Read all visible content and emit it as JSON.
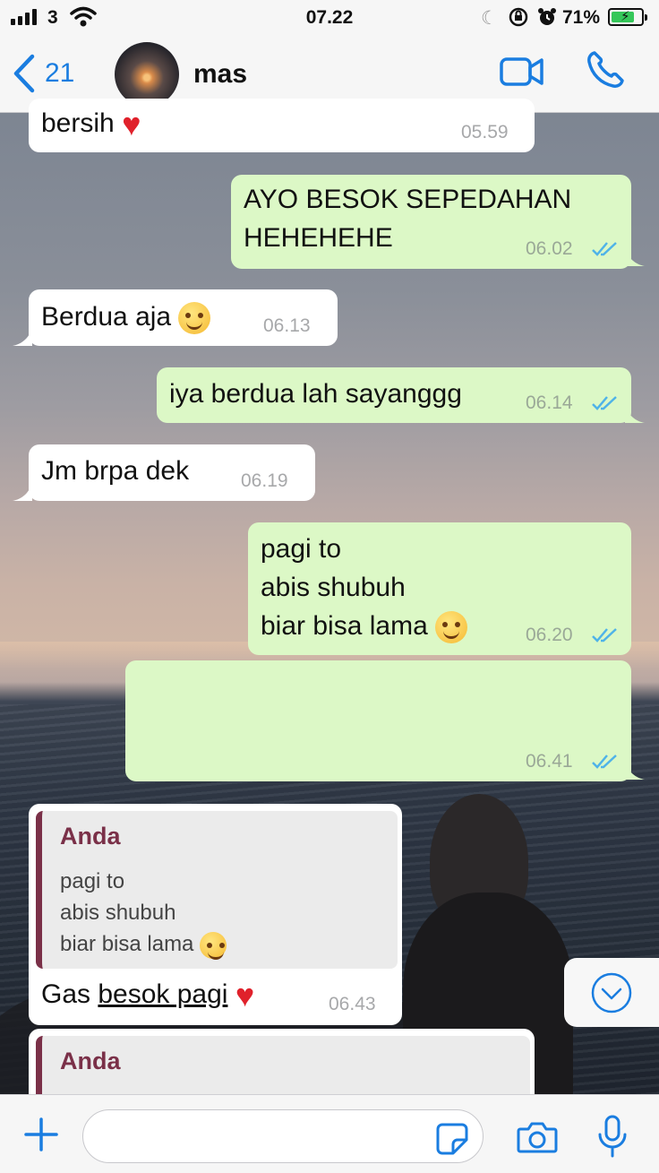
{
  "status_bar": {
    "carrier": "3",
    "time": "07.22",
    "battery_percent": "71%"
  },
  "header": {
    "back_count": "21",
    "contact_name": "mas"
  },
  "messages": [
    {
      "id": "m0",
      "direction": "incoming",
      "text": "bersih",
      "emoji": "red-heart",
      "time": "05.59"
    },
    {
      "id": "m1",
      "direction": "outgoing",
      "lines": [
        "AYO BESOK SEPEDAHAN",
        "HEHEHEHE"
      ],
      "time": "06.02",
      "status": "read"
    },
    {
      "id": "m2",
      "direction": "incoming",
      "text": "Berdua aja",
      "emoji": "face-with-hand-smile",
      "time": "06.13"
    },
    {
      "id": "m3",
      "direction": "outgoing",
      "text": "iya berdua lah sayanggg",
      "time": "06.14",
      "status": "read"
    },
    {
      "id": "m4",
      "direction": "incoming",
      "text": "Jm brpa dek",
      "time": "06.19"
    },
    {
      "id": "m5",
      "direction": "outgoing",
      "lines": [
        "pagi to",
        "abis shubuh",
        "biar bisa lama"
      ],
      "emoji": "savoring-face",
      "time": "06.20",
      "status": "read"
    },
    {
      "id": "m6",
      "direction": "outgoing",
      "text": "",
      "time": "06.41",
      "status": "read"
    },
    {
      "id": "m7",
      "direction": "incoming",
      "quote": {
        "author": "Anda",
        "lines": [
          "pagi to",
          "abis shubuh",
          "biar bisa lama"
        ],
        "emoji": "savoring-face"
      },
      "text_prefix": "Gas ",
      "text_underlined": "besok pagi",
      "emoji": "red-heart",
      "time": "06.43"
    },
    {
      "id": "m8",
      "direction": "incoming",
      "quote": {
        "author": "Anda"
      }
    }
  ],
  "input": {
    "placeholder": ""
  },
  "colors": {
    "outgoing_bubble": "#dcf8c6",
    "incoming_bubble": "#ffffff",
    "accent": "#1a7de0",
    "read_ticks": "#4fb3e8",
    "quote_author": "#7a3048"
  },
  "icons": [
    "back-chevron-icon",
    "video-call-icon",
    "phone-icon",
    "read-receipt-icon",
    "scroll-down-icon",
    "plus-icon",
    "sticker-icon",
    "camera-icon",
    "microphone-icon"
  ]
}
